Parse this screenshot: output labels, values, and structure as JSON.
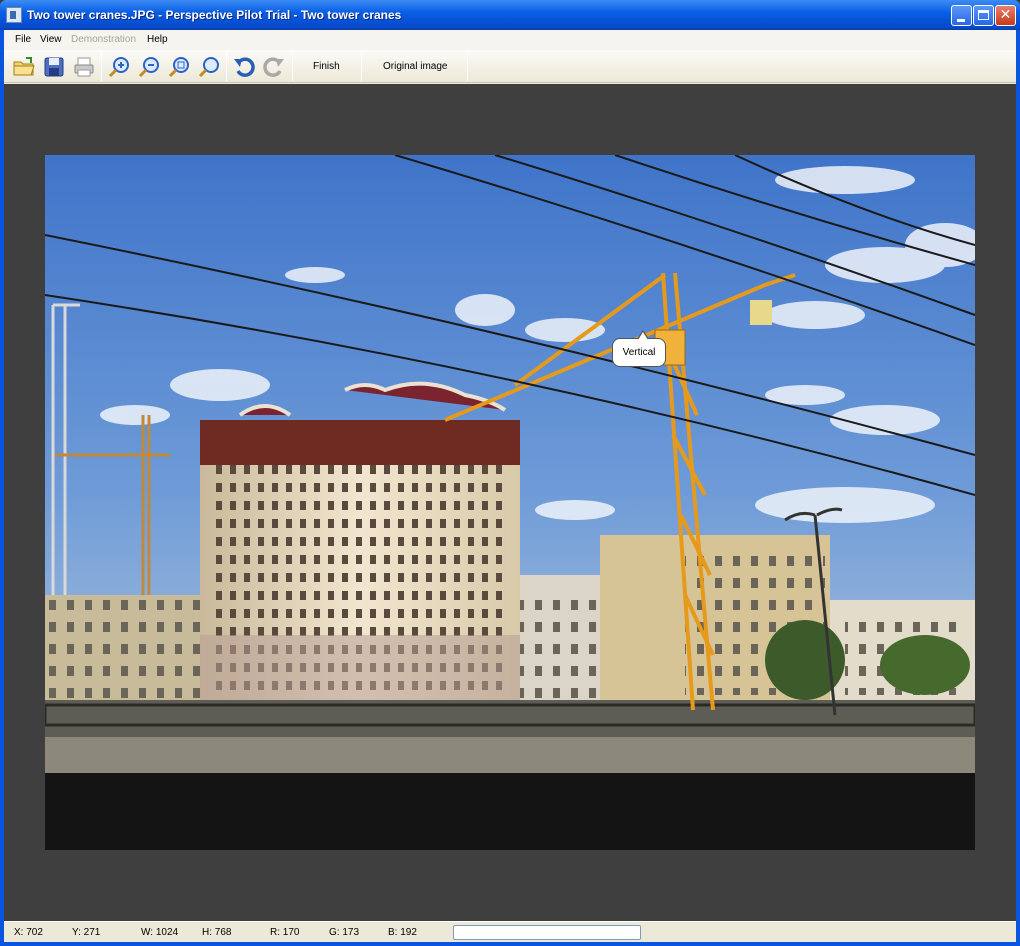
{
  "window": {
    "title": "Two tower cranes.JPG - Perspective Pilot Trial - Two tower cranes",
    "controls": {
      "minimize": "minimize-icon",
      "maximize": "maximize-icon",
      "close": "close-icon"
    }
  },
  "menubar": {
    "items": [
      {
        "label": "File",
        "enabled": true
      },
      {
        "label": "View",
        "enabled": true
      },
      {
        "label": "Demonstration",
        "enabled": false
      },
      {
        "label": "Help",
        "enabled": true
      }
    ]
  },
  "toolbar": {
    "icons": [
      "open-folder-icon",
      "save-icon",
      "print-icon",
      "zoom-in-icon",
      "zoom-out-icon",
      "zoom-fit-icon",
      "zoom-actual-icon",
      "undo-icon",
      "redo-icon"
    ],
    "finish_label": "Finish",
    "original_label": "Original image"
  },
  "image": {
    "callout_label": "Vertical"
  },
  "status": {
    "x": "X: 702",
    "y": "Y: 271",
    "w": "W: 1024",
    "h": "H: 768",
    "r": "R: 170",
    "g": "G: 173",
    "b": "B: 192",
    "progress": 0
  }
}
